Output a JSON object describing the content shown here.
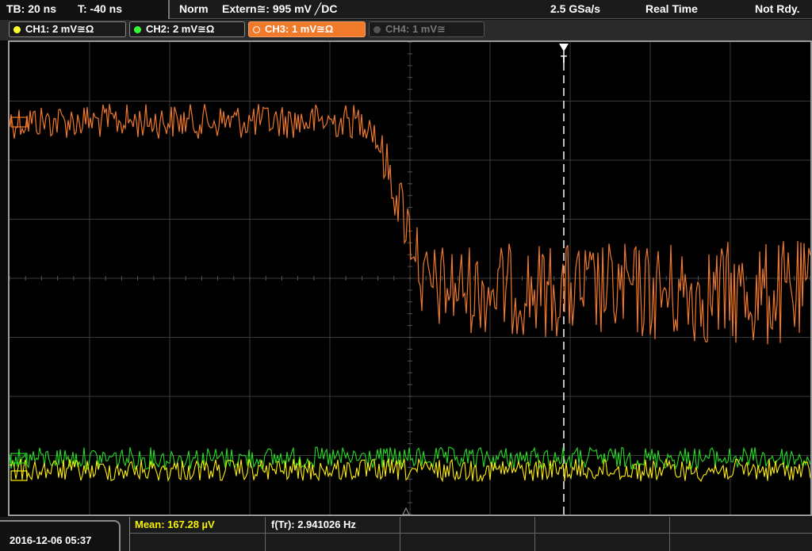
{
  "status": {
    "timebase": "TB: 20 ns",
    "trigger_offset": "T: -40 ns",
    "acq_mode": "Norm",
    "trigger_source": "Extern≅: 995 mV ╱DC",
    "sample_rate": "2.5 GSa/s",
    "mode": "Real Time",
    "state": "Not Rdy."
  },
  "channels": [
    {
      "label": "CH1: 2 mV≅Ω",
      "color": "#ffff30",
      "active": false
    },
    {
      "label": "CH2: 2 mV≅Ω",
      "color": "#30ff30",
      "active": false
    },
    {
      "label": "CH3: 1 mV≅Ω",
      "color": "#f07a2a",
      "active": true
    },
    {
      "label": "CH4: 1 mV≅",
      "color": "#555555",
      "active": false
    }
  ],
  "trigger_marker": "T",
  "colors": {
    "ch1": "#ffee00",
    "ch2": "#22dd22",
    "ch3": "#f0782a",
    "grid": "#3a3a3a"
  },
  "measurements": {
    "mean": "Mean: 167.28 µV",
    "freq": "f(Tr): 2.941026 Hz"
  },
  "datetime": "2016-12-06 05:37"
}
